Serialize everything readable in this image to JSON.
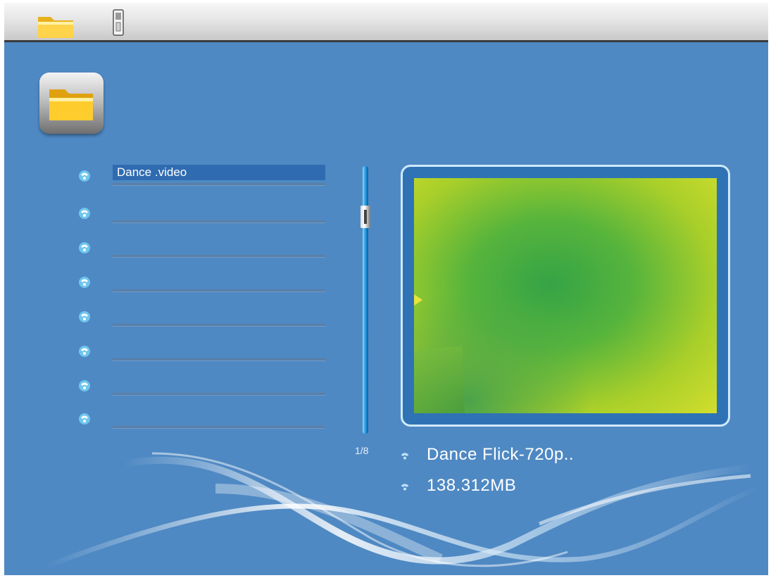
{
  "topbar": {
    "icons": [
      "folder-icon",
      "memory-card-icon"
    ]
  },
  "header": {
    "icon": "folder-icon"
  },
  "file_list": {
    "items": [
      {
        "label": "Dance .video",
        "selected": true
      },
      {
        "label": ""
      },
      {
        "label": ""
      },
      {
        "label": ""
      },
      {
        "label": ""
      },
      {
        "label": ""
      },
      {
        "label": ""
      },
      {
        "label": ""
      }
    ],
    "page_indicator": "1/8"
  },
  "preview": {
    "file_name": "Dance Flick-720p..",
    "file_size": "138.312MB"
  },
  "colors": {
    "background": "#4f89c3",
    "selection": "#2f6bb0",
    "preview_border": "#cfe9fb"
  }
}
